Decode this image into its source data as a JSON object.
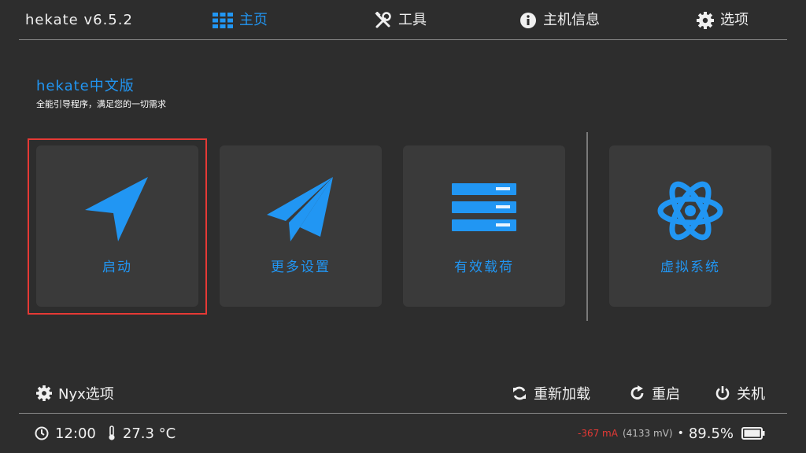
{
  "header": {
    "title": "hekate v6.5.2",
    "tabs": [
      {
        "label": "主页",
        "icon": "grid-icon",
        "active": true
      },
      {
        "label": "工具",
        "icon": "tools-icon",
        "active": false
      },
      {
        "label": "主机信息",
        "icon": "info-icon",
        "active": false
      },
      {
        "label": "选项",
        "icon": "gear-icon",
        "active": false
      }
    ]
  },
  "brand": {
    "name": "hekate中文版",
    "tagline": "全能引导程序，满足您的一切需求"
  },
  "tiles": [
    {
      "label": "启动",
      "icon": "navigation-arrow-icon",
      "selected": true
    },
    {
      "label": "更多设置",
      "icon": "paper-plane-icon",
      "selected": false
    },
    {
      "label": "有效载荷",
      "icon": "stack-bars-icon",
      "selected": false
    },
    {
      "label": "虚拟系统",
      "icon": "atom-icon",
      "selected": false
    }
  ],
  "footer": {
    "nyx_options": "Nyx选项",
    "reload": "重新加载",
    "reboot": "重启",
    "power_off": "关机"
  },
  "status": {
    "time": "12:00",
    "temperature": "27.3 °C",
    "current": "-367 mA",
    "voltage": "(4133 mV)",
    "separator": "•",
    "battery": "89.5%"
  },
  "colors": {
    "accent": "#2196f3",
    "background": "#2d2d2d",
    "tile": "#3a3a3a",
    "selection": "#e53935"
  }
}
